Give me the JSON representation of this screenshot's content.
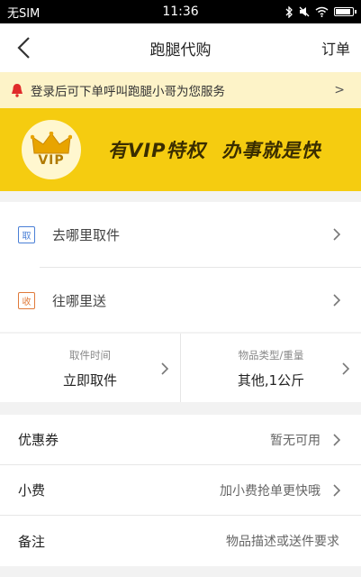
{
  "status_bar": {
    "carrier": "无SIM",
    "time": "11:36"
  },
  "nav": {
    "title": "跑腿代购",
    "right_link": "订单"
  },
  "notice": {
    "text": "登录后可下单呼叫跑腿小哥为您服务",
    "arrow": ">"
  },
  "vip_banner": {
    "badge_text": "VIP",
    "slogan_part1": "有VIP特权",
    "slogan_part2": "办事就是快"
  },
  "address": {
    "pickup": {
      "tag": "取",
      "label": "去哪里取件",
      "tag_color": "#4a7fd6"
    },
    "deliver": {
      "tag": "收",
      "label": "往哪里送",
      "tag_color": "#e07a3a"
    }
  },
  "options": {
    "pickup_time": {
      "label": "取件时间",
      "value": "立即取件"
    },
    "item_type": {
      "label": "物品类型/重量",
      "value": "其他,1公斤"
    }
  },
  "list": {
    "coupon": {
      "label": "优惠券",
      "value": "暂无可用"
    },
    "tip": {
      "label": "小费",
      "value": "加小费抢单更快哦"
    },
    "remark": {
      "label": "备注",
      "value": "物品描述或送件要求"
    }
  },
  "colors": {
    "brand_yellow": "#f5cc10",
    "notice_bg": "#fdf3c8"
  }
}
